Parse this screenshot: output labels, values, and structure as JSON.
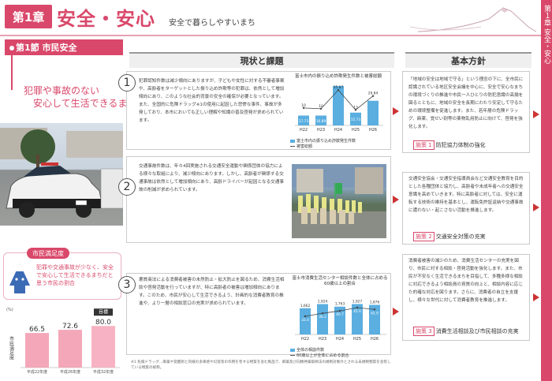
{
  "header": {
    "chapter": "第1章",
    "title": "安全・安心",
    "subtitle": "安全で暮らしやすいまち",
    "side_tab": "第１章 安全・安心"
  },
  "section": {
    "label": "第1節 市民安全",
    "slogan_line1": "犯罪や事故のない",
    "slogan_line2": "安心して生活できるまち"
  },
  "satisfaction": {
    "tag": "市民満足度",
    "description": "犯罪や交通事故が少なく、安全で安心して生活できるまちだと思う市民の割合",
    "ylabel": "市民満足度",
    "unit": "(%)",
    "target_label": "目標",
    "bars": [
      {
        "label": "平成22年度",
        "value": "66.5"
      },
      {
        "label": "平成26年度",
        "value": "72.6"
      },
      {
        "label": "平成32年度",
        "value": "80.0"
      }
    ]
  },
  "columns": {
    "current": "現状と課題",
    "policy": "基本方針"
  },
  "items": [
    {
      "num": "1",
      "text": "犯罪認知件数は減少傾向にありますが、子どもや女性に対する不審者事案や、高齢者をターゲットとした振り込め詐欺等の犯罪は、依然として増加傾向にあり、このような社会的背景の安全の確保が必要となっています。また、全国的に危険ドラッグ※1の使用に起因した悲惨な事件、事故が多発しており、本市においても正しい理解や知識の普及啓発が求められています。",
      "policy_text": "「地域の安全は地域で守る」という理念の下に、全市民に認識されている地区安全会議を中心に、安全で安心なまちの環境づくりの推進や市民一人ひとりの防犯意識の高揚を図るとともに、地域の安全を長期にわたり安定して守るための環境整備を促進します。また、若年層の危険ドラッグ、麻薬、覚せい剤等の薬物乱用防止に向けて、啓発を強化します。",
      "policy_tag": "施策 1",
      "policy_name": "防犯協力体制の強化"
    },
    {
      "num": "2",
      "text": "交通事故件数は、年々4回実施される交通安全運動や関係団体の協力による様々な取組により、減少傾向にあります。しかし、高齢者が関係する交通事故は依然として増加傾向にあり、高齢ドライバーが起因となる交通事故の削減が求められています。",
      "policy_text": "交通安全協会・交通安全指導員会など交通安全教育を目的とした各種団体と協力し、高齢者や未成年者への交通安全意識を高めていきます。特に高齢者に対しては、安全に運転する技術の維持を基本とし、運転免許証返納や交通事故に遭わない・起こさない活動を推進します。",
      "policy_tag": "施策 2",
      "policy_name": "交通安全対策の充実"
    },
    {
      "num": "3",
      "text": "悪質商法による消費者被害の未然防止・拡大防止を図るため、消費生活相談や啓発活動を行っていますが、特に高齢者の被害は増加傾向にあります。このため、市民が安心して生活できるよう、計画的な消費者教育の推進や、より一層の相談窓口の充実が求められています。",
      "policy_text": "消費者被害の減少のため、消費生活センターの充実を図り、市民に対する相談・啓発活動を強化します。また、市民が不安なく生活できるまちを目指して、多種多様な相談に対応できるよう相談員の資質の向上と、相談内容に応じた的確な対応を図ります。さらに、消費者の自立を支援し、様々な世代に対して消費者教育を推進します。",
      "policy_tag": "施策 3",
      "policy_name": "消費生活相談及び市民相談の充実"
    }
  ],
  "footnote": "※1 危険ドラッグ…麻薬や覚醒剤と同様の多幸感や幻覚等の作用を有する物質を含む製品で、麻薬及び向精神薬取締法の規制対象外とされる未規制物質を含有している物質の総称。",
  "chart_data": [
    {
      "type": "bar",
      "title": "富士市内の振り込め詐欺発生件数と被害総額",
      "categories": [
        "H22",
        "H23",
        "H24",
        "H25",
        "H26"
      ],
      "series": [
        {
          "name": "富士市内の振り込め詐欺発生件数",
          "values": [
            10,
            10,
            40,
            13,
            25
          ]
        },
        {
          "name": "被害総額",
          "values": [
            17.73,
            16.89,
            35.87,
            15.73,
            29.84
          ]
        }
      ],
      "labels_top": [
        "10",
        "10",
        "35.87",
        "13",
        "29.84"
      ],
      "labels_in": [
        "17.73",
        "16.89",
        "",
        "15.73",
        ""
      ],
      "ylim": [
        0,
        40
      ]
    },
    {
      "type": "bar",
      "title": "富士市消費生活センター相談件数と全体に占める60歳以上の割合",
      "categories": [
        "H22",
        "H23",
        "H24",
        "H25",
        "H26"
      ],
      "series": [
        {
          "name": "全体の相談件数",
          "values": [
            1662,
            1924,
            1763,
            1927,
            1876
          ]
        },
        {
          "name": "60歳以上が全体に占める割合",
          "values": [
            32.4,
            37.0,
            40.7,
            45.6,
            42.9
          ]
        }
      ],
      "bar_labels": [
        "1,662",
        "1,924",
        "1,763",
        "1,927",
        "1,876"
      ],
      "pct_labels": [
        "33.4",
        "36.2",
        "40.7",
        "45.6",
        "42.9"
      ],
      "ylim": [
        0,
        2500
      ]
    }
  ]
}
